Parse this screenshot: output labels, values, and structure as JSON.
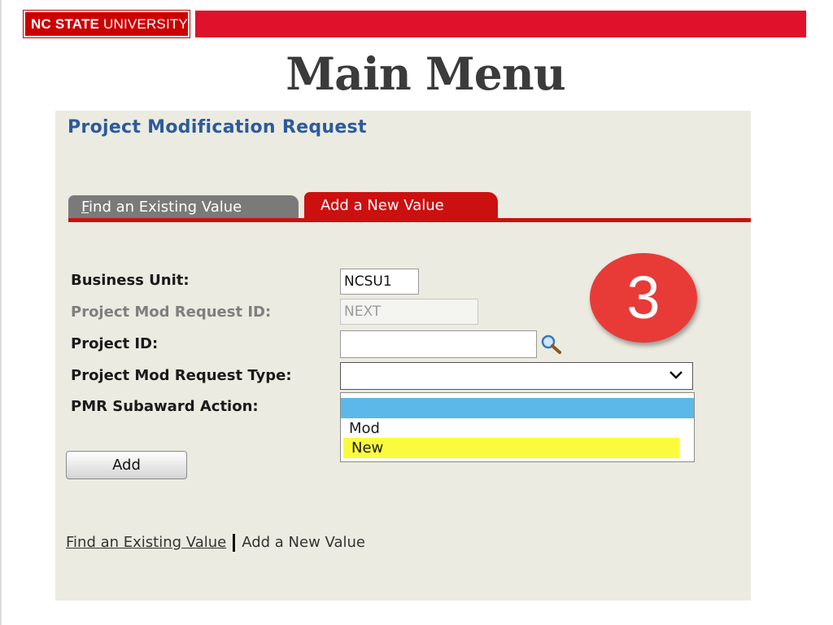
{
  "header": {
    "logo_bold": "NC STATE",
    "logo_rest": " UNIVERSITY",
    "slide_title": "Main Menu",
    "brand_red": "#cc0000"
  },
  "panel": {
    "title": "Project Modification Request",
    "tabs": {
      "find": {
        "accel": "F",
        "rest": "ind an Existing Value"
      },
      "add": {
        "label": "Add a New Value"
      }
    },
    "fields": {
      "business_unit": {
        "label": "Business Unit:",
        "value": "NCSU1"
      },
      "request_id": {
        "label": "Project Mod Request ID:",
        "value": "NEXT"
      },
      "project_id": {
        "label": "Project ID:",
        "value": ""
      },
      "request_type": {
        "label": "Project Mod Request Type:",
        "value": ""
      },
      "subaward_action": {
        "label": "PMR Subaward Action:"
      }
    },
    "dropdown_options": [
      "",
      "Mod",
      "New"
    ],
    "add_button": "Add",
    "bottom_links": {
      "find": "Find an Existing Value",
      "add": "Add a New Value"
    }
  },
  "annotation": {
    "step": "3",
    "color": "#e83b38"
  }
}
